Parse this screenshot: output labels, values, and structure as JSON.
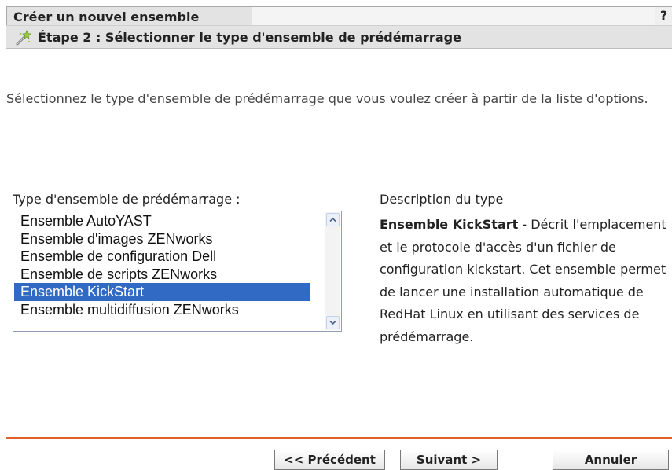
{
  "window": {
    "title": "Créer un nouvel ensemble",
    "help_label": "?"
  },
  "step": {
    "icon": "magic-wand-icon",
    "title": "Étape 2 : Sélectionner le type d'ensemble de prédémarrage"
  },
  "intro": "Sélectionnez le type d'ensemble de prédémarrage que vous voulez créer à partir de la liste d'options.",
  "type_list": {
    "label": "Type d'ensemble de prédémarrage :",
    "items": [
      "Ensemble AutoYAST",
      "Ensemble d'images ZENworks",
      "Ensemble de configuration Dell",
      "Ensemble de scripts ZENworks",
      "Ensemble KickStart",
      "Ensemble multidiffusion ZENworks"
    ],
    "selected": "Ensemble KickStart"
  },
  "description": {
    "heading": "Description du type",
    "name": "Ensemble KickStart",
    "text": " - Décrit l'emplacement et le protocole d'accès d'un fichier de configuration kickstart. Cet ensemble permet de lancer une installation automatique de RedHat Linux en utilisant des services de prédémarrage."
  },
  "buttons": {
    "previous": "<< Précédent",
    "next": "Suivant >",
    "cancel": "Annuler"
  },
  "colors": {
    "accent_divider": "#e06028",
    "selection": "#316ac5"
  }
}
